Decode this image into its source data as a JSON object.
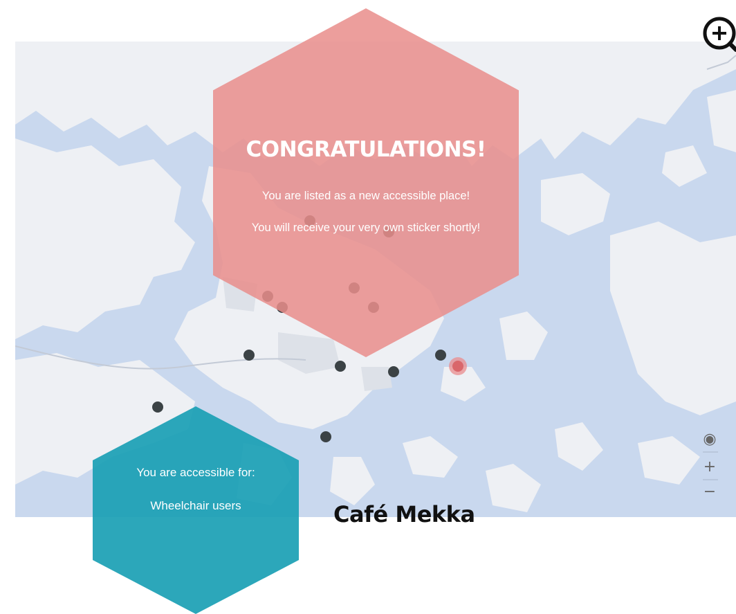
{
  "congrats": {
    "title": "CONGRATULATIONS!",
    "line1": "You are listed as a new accessible place!",
    "line2": "You will receive your very own sticker shortly!"
  },
  "accessibility": {
    "label": "You are accessible for:",
    "items": [
      "Wheelchair users"
    ]
  },
  "place": {
    "name": "Café Mekka"
  },
  "map_controls": {
    "zoom_in": "+",
    "zoom_out": "−",
    "locate": "◉"
  },
  "colors": {
    "water": "#c9d8ee",
    "land": "#eef0f4",
    "congrats_hex": "#e98e8c",
    "access_hex": "#1aa0b4",
    "pin": "#3b4245",
    "pin_selected": "#d9676b"
  }
}
